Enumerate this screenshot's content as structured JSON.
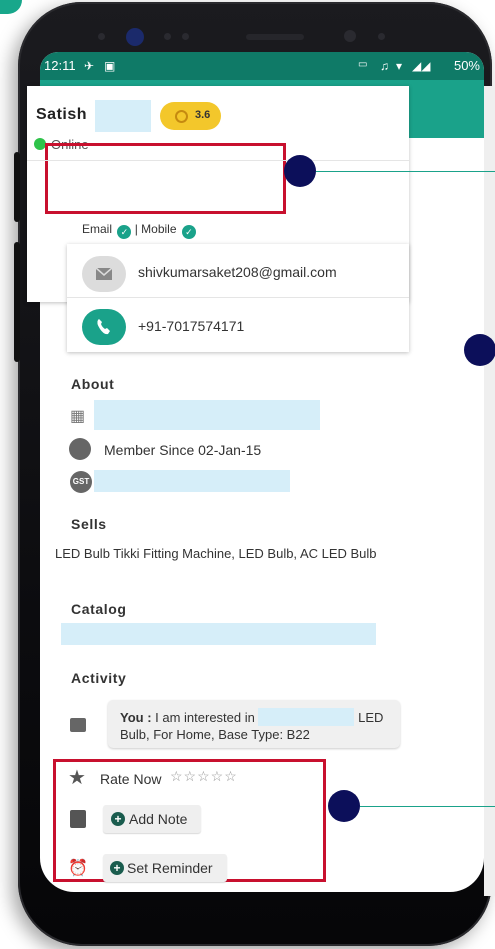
{
  "status_bar": {
    "time": "12:11",
    "battery": "50%"
  },
  "profile": {
    "name": "Satish",
    "rating": "3.6",
    "status": "Online",
    "email_label": "Email",
    "mobile_label": "| Mobile",
    "email": "shivkumarsaket208@gmail.com",
    "phone": "+91-7017574171"
  },
  "about": {
    "heading": "About",
    "member_since": "Member Since 02-Jan-15",
    "gst_badge": "GST"
  },
  "sells": {
    "heading": "Sells",
    "text": "LED Bulb Tikki Fitting Machine, LED Bulb, AC LED Bulb"
  },
  "catalog": {
    "heading": "Catalog"
  },
  "activity": {
    "heading": "Activity",
    "prefix": "You :",
    "message_start": " I am interested in",
    "message_mid": "LED",
    "message_end": "Bulb, For Home, Base Type: B22"
  },
  "actions": {
    "rate_label": "Rate Now",
    "stars": "☆☆☆☆☆",
    "add_note": "Add Note",
    "set_reminder": "Set Reminder"
  },
  "colors": {
    "accent": "#1aa28a",
    "highlight_box": "#c8102e",
    "marker": "#0c0f5a",
    "rating_badge": "#f3c72b",
    "online": "#2fc34a"
  }
}
